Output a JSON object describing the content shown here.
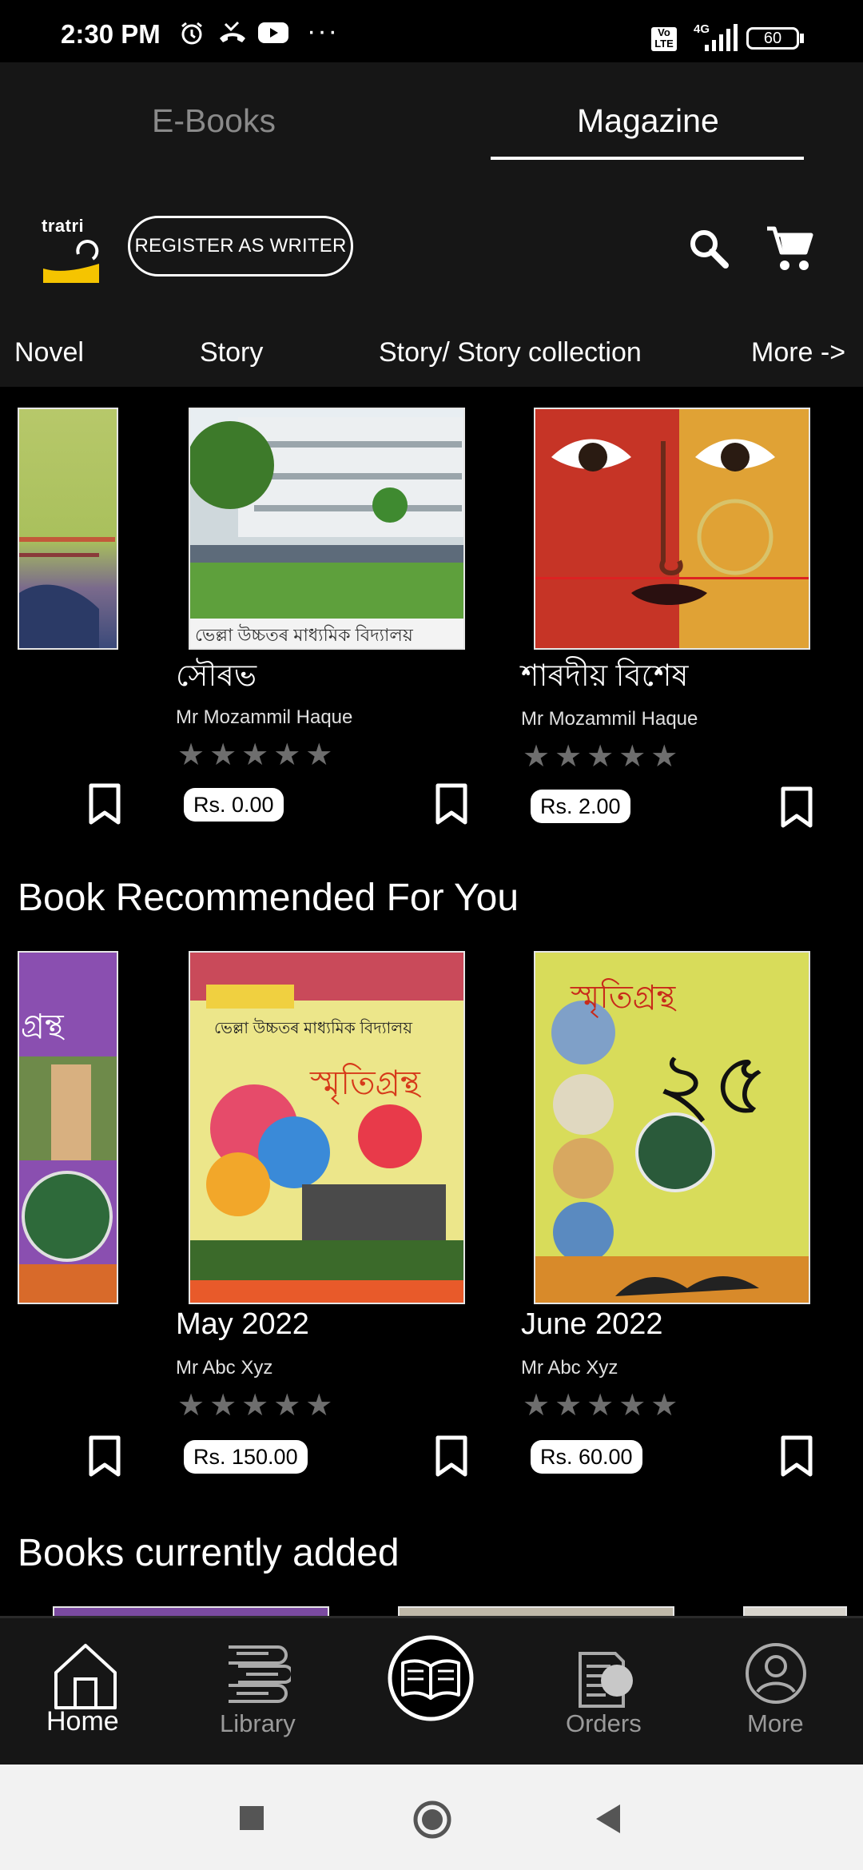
{
  "status_bar": {
    "time": "2:30 PM",
    "dots": "···",
    "network": "4G",
    "volte": "Vo LTE",
    "battery": "60"
  },
  "top_tabs": [
    {
      "label": "E-Books",
      "active": false
    },
    {
      "label": "Magazine",
      "active": true
    }
  ],
  "header": {
    "logo_text": "tratri",
    "register_label": "REGISTER AS WRITER"
  },
  "categories": [
    "Novel",
    "Story",
    "Story/ Story collection",
    "More ->"
  ],
  "row1": [
    {
      "title": "সৌৰভ",
      "author": "Mr Mozammil Haque",
      "price": "Rs. 0.00",
      "cover_caption": "ভেল্লা উচ্চতৰ মাধ্যমিক বিদ্যালয়"
    },
    {
      "title": "শাৰদীয় বিশেষ",
      "author": "Mr Mozammil Haque",
      "price": "Rs. 2.00"
    }
  ],
  "recommended": {
    "title": "Book Recommended For You",
    "books": [
      {
        "title": "May 2022",
        "author": "Mr Abc Xyz",
        "price": "Rs. 150.00",
        "cover_text": "স্মৃতিগ্ৰন্থ",
        "cover_subtitle": "ভেল্লা উচ্চতৰ মাধ্যমিক বিদ্যালয়"
      },
      {
        "title": "June 2022",
        "author": "Mr Abc Xyz",
        "price": "Rs. 60.00",
        "cover_text": "স্মৃতিগ্ৰন্থ",
        "cover_number": "২৫"
      }
    ],
    "partial_cover_text": "গ্ৰন্থ"
  },
  "currently_added": {
    "title": "Books currently added"
  },
  "bottom_nav": [
    {
      "label": "Home",
      "active": true
    },
    {
      "label": "Library",
      "active": false
    },
    {
      "label": "",
      "active": false
    },
    {
      "label": "Orders",
      "active": false
    },
    {
      "label": "More",
      "active": false
    }
  ],
  "colors": {
    "background": "#000000",
    "panel": "#161616",
    "text": "#ffffff",
    "muted": "#8a8a8a",
    "star": "#6e6e6e",
    "logo_yellow": "#f5c400"
  }
}
